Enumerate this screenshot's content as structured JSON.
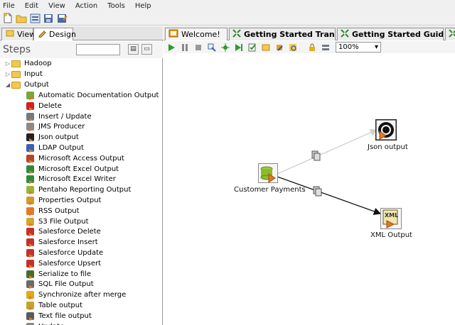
{
  "menu": [
    "File",
    "Edit",
    "View",
    "Action",
    "Tools",
    "Help"
  ],
  "left_panel": {
    "tab_view": "View",
    "tab_design": "Design",
    "steps_title": "Steps",
    "search_value": ""
  },
  "tree": {
    "folders": [
      {
        "label": "Hadoop",
        "expanded": false
      },
      {
        "label": "Input",
        "expanded": false
      },
      {
        "label": "Output",
        "expanded": true
      }
    ],
    "output_items": [
      {
        "label": "Automatic Documentation Output",
        "icon": "doc-output-icon",
        "color": "#7aa63a"
      },
      {
        "label": "Delete",
        "icon": "delete-icon",
        "color": "#d21f1f"
      },
      {
        "label": "Insert / Update",
        "icon": "insert-update-icon",
        "color": "#6f7a87"
      },
      {
        "label": "JMS Producer",
        "icon": "jms-icon",
        "color": "#8a8a8a"
      },
      {
        "label": "Json output",
        "icon": "json-icon",
        "color": "#222222"
      },
      {
        "label": "LDAP Output",
        "icon": "ldap-icon",
        "color": "#3a62b5"
      },
      {
        "label": "Microsoft Access Output",
        "icon": "access-icon",
        "color": "#b5442a"
      },
      {
        "label": "Microsoft Excel Output",
        "icon": "excel-icon",
        "color": "#2f8a3c"
      },
      {
        "label": "Microsoft Excel Writer",
        "icon": "excel-writer-icon",
        "color": "#2f8a3c"
      },
      {
        "label": "Pentaho Reporting Output",
        "icon": "reporting-icon",
        "color": "#9cb33a"
      },
      {
        "label": "Properties Output",
        "icon": "properties-icon",
        "color": "#d29a2c"
      },
      {
        "label": "RSS Output",
        "icon": "rss-icon",
        "color": "#e6782a"
      },
      {
        "label": "S3 File Output",
        "icon": "s3-icon",
        "color": "#d6a52c"
      },
      {
        "label": "Salesforce Delete",
        "icon": "salesforce-delete-icon",
        "color": "#c4302b"
      },
      {
        "label": "Salesforce Insert",
        "icon": "salesforce-insert-icon",
        "color": "#c4302b"
      },
      {
        "label": "Salesforce Update",
        "icon": "salesforce-update-icon",
        "color": "#c4302b"
      },
      {
        "label": "Salesforce Upsert",
        "icon": "salesforce-upsert-icon",
        "color": "#c4302b"
      },
      {
        "label": "Serialize to file",
        "icon": "serialize-icon",
        "color": "#4a6a2a"
      },
      {
        "label": "SQL File Output",
        "icon": "sql-file-icon",
        "color": "#6a6a6a"
      },
      {
        "label": "Synchronize after merge",
        "icon": "sync-icon",
        "color": "#e0a81c"
      },
      {
        "label": "Table output",
        "icon": "table-output-icon",
        "color": "#caa22a"
      },
      {
        "label": "Text file output",
        "icon": "text-file-icon",
        "color": "#5a5a5a"
      },
      {
        "label": "Update",
        "icon": "update-icon",
        "color": "#888888"
      }
    ]
  },
  "editor_tabs": [
    {
      "label": "Welcome!",
      "icon": "welcome-icon"
    },
    {
      "label": "Getting Started Tran",
      "icon": "transformation-icon"
    },
    {
      "label": "Getting Started Guid",
      "icon": "transformation-icon"
    },
    {
      "label": "",
      "icon": "transformation-icon"
    }
  ],
  "zoom": "100%",
  "canvas": {
    "nodes": {
      "source": "Customer Payments",
      "json": "Json output",
      "xml": "XML Output"
    }
  },
  "colors": {
    "run": "#2c9a2c",
    "tab_icon": "#2a8a2a",
    "hop": "#111111",
    "hop_disabled": "#cfcfcf"
  }
}
